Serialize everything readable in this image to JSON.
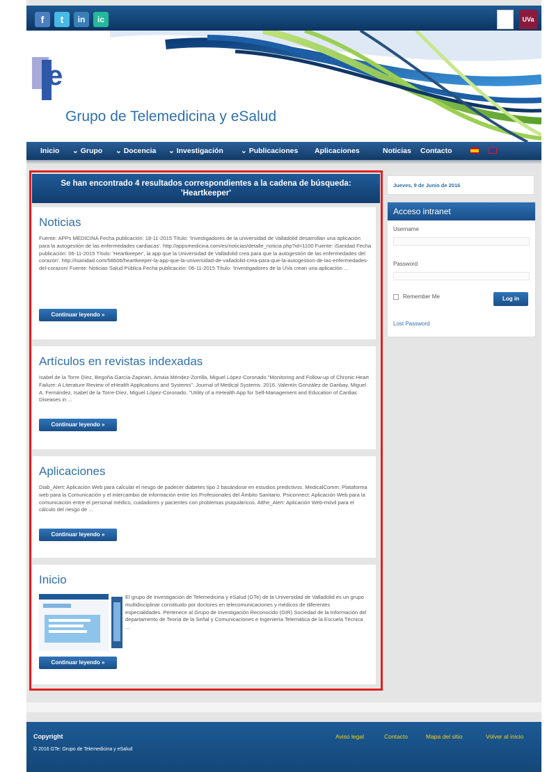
{
  "social": {
    "facebook": "f",
    "twitter": "t",
    "linkedin": "in",
    "other": "ic"
  },
  "right_logos": {
    "logo1": "",
    "uva": "UVa"
  },
  "header": {
    "logo_text": "GTe",
    "site_title": "Grupo de Telemedicina y eSalud"
  },
  "nav": {
    "items": [
      {
        "label": "Inicio"
      },
      {
        "label": "⌄ Grupo"
      },
      {
        "label": "⌄ Docencia"
      },
      {
        "label": "⌄ Investigación"
      },
      {
        "label": "⌄ Publicaciones"
      },
      {
        "label": "Aplicaciones"
      },
      {
        "label": "Noticias"
      },
      {
        "label": "Contacto"
      }
    ]
  },
  "search": {
    "header_line1": "Se han encontrado 4 resultados correspondientes a la cadena de búsqueda:",
    "header_line2": "'Heartkeeper'"
  },
  "results": [
    {
      "title": "Noticias",
      "text": "Fuente: APPs MEDICINA Fecha publicación: 18-11-2015 Título: 'Investigadores de la universidad de Valladolid desarrollan una aplicación para la autogestión de las enfermedades cardiacas'. http://appsmedicina.com/es/noticias/detalle_noticia.php?id=1100 Fuente: iSanidad Fecha publicación: 06-11-2015 Título: 'Heartkeeper', la app que la Universidad de Valladolid crea para que la autogestión de las enfermedades del corazón'. http://isanidad.com/58606/heartkeeper-la-app-que-la-universidad-de-valladolid-crea-para-que-la-autogestion-de-las-enfermedades-del-corazon/ Fuente: Noticias Salud Pública Fecha publicación: 06-11-2015 Título: 'Investigadores de la UVa crean una aplicación ...",
      "button": "Continuar leyendo »"
    },
    {
      "title": "Artículos en revistas indexadas",
      "text": "Isabel de la Torre Díez, Begoña García-Zapirain, Amaia Méndez-Zorrilla, Miguel López-Coronado.\"Monitoring and Follow-up of Chronic Heart Failure: A Literature Review of eHealth Applications and Systems\". Journal of Medical Systems. 2016. Valentín González de Garibay, Miguel A. Fernández, Isabel de la Torre-Díez, Miguel López-Coronado. \"Utility of a mHealth App for Self-Management and Education of Cardiac Diseases in ...",
      "button": "Continuar leyendo »"
    },
    {
      "title": "Aplicaciones",
      "text": "Diab_Alert: Aplicación Web para calcular el riesgo de padecer diabetes tipo 2 basándose en estudios predictivos. MedicalComm: Plataforma web para la Comunicación y el intercambio de información entre los Profesionales del Ámbito Sanitario. Psiconnect: Aplicación Web para la comunicación entre el personal médico, cuidadores y pacientes con problemas psiquiátricos. Atthe_Alert: Aplicación Web-móvil para el cálculo del riesgo de ...",
      "button": "Continuar leyendo »"
    },
    {
      "title": "Inicio",
      "text": "El grupo de Investigación de Telemedicina y eSalud (GTe) de la Universidad de Valladolid es un grupo multidisciplinar constituido por doctores en telecomunicaciones y médicos de diferentes especialidades. Pertenece al Grupo de Investigación Reconocido (GIR) Sociedad de la Información del departamento de Teoría de la Señal y Comunicaciones e Ingeniería Telemática de la Escuela Técnica ...",
      "button": "Continuar leyendo »"
    }
  ],
  "sidebar": {
    "date": "Jueves, 9 de Junio de 2016",
    "intranet_title": "Acceso intranet",
    "username_label": "Username",
    "password_label": "Password",
    "remember_label": "Remember Me",
    "login_button": "Log in",
    "lost_password": "Lost Password"
  },
  "footer": {
    "copyright_title": "Copyright",
    "copyright_text": "© 2016 GTe: Grupo de Telemedicina y eSalud",
    "links": [
      "Aviso legal",
      "Contacto",
      "Mapa del sitio",
      "Volver al inicio"
    ]
  },
  "colors": {
    "accent": "#2f6fa8",
    "nav_dark": "#123a66",
    "footer_link": "#f2d11a",
    "highlight_frame": "#e02020"
  }
}
